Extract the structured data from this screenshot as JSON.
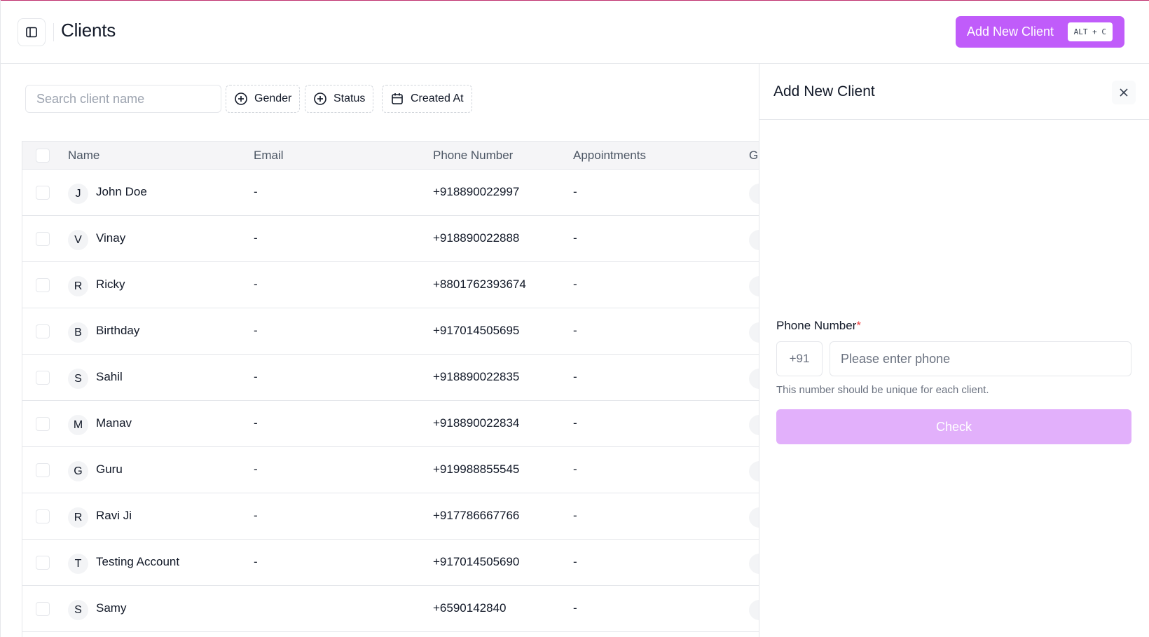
{
  "header": {
    "title": "Clients",
    "add_button_label": "Add New Client",
    "add_button_shortcut": "ALT + C"
  },
  "toolbar": {
    "search_placeholder": "Search client name",
    "filters": [
      {
        "label": "Gender",
        "icon": "plus-circle-icon"
      },
      {
        "label": "Status",
        "icon": "plus-circle-icon"
      },
      {
        "label": "Created At",
        "icon": "calendar-icon"
      }
    ]
  },
  "table": {
    "columns": [
      "Name",
      "Email",
      "Phone Number",
      "Appointments",
      "G"
    ],
    "rows": [
      {
        "initial": "J",
        "name": "John Doe",
        "email": "-",
        "phone": "+918890022997",
        "appointments": "-"
      },
      {
        "initial": "V",
        "name": "Vinay",
        "email": "-",
        "phone": "+918890022888",
        "appointments": "-"
      },
      {
        "initial": "R",
        "name": "Ricky",
        "email": "-",
        "phone": "+8801762393674",
        "appointments": "-"
      },
      {
        "initial": "B",
        "name": "Birthday",
        "email": "-",
        "phone": "+917014505695",
        "appointments": "-"
      },
      {
        "initial": "S",
        "name": "Sahil",
        "email": "-",
        "phone": "+918890022835",
        "appointments": "-"
      },
      {
        "initial": "M",
        "name": "Manav",
        "email": "-",
        "phone": "+918890022834",
        "appointments": "-"
      },
      {
        "initial": "G",
        "name": "Guru",
        "email": "-",
        "phone": "+919988855545",
        "appointments": "-"
      },
      {
        "initial": "R",
        "name": "Ravi Ji",
        "email": "-",
        "phone": "+917786667766",
        "appointments": "-"
      },
      {
        "initial": "T",
        "name": "Testing Account",
        "email": "-",
        "phone": "+917014505690",
        "appointments": "-"
      },
      {
        "initial": "S",
        "name": "Samy",
        "email": "",
        "phone": "+6590142840",
        "appointments": "-"
      }
    ]
  },
  "drawer": {
    "title": "Add New Client",
    "phone_label": "Phone Number",
    "required_mark": "*",
    "country_code": "+91",
    "phone_placeholder": "Please enter phone",
    "hint": "This number should be unique for each client.",
    "check_label": "Check"
  },
  "colors": {
    "accent": "#c05cfa",
    "accent_disabled": "#e2b0fb",
    "top_border": "#c0306e"
  }
}
